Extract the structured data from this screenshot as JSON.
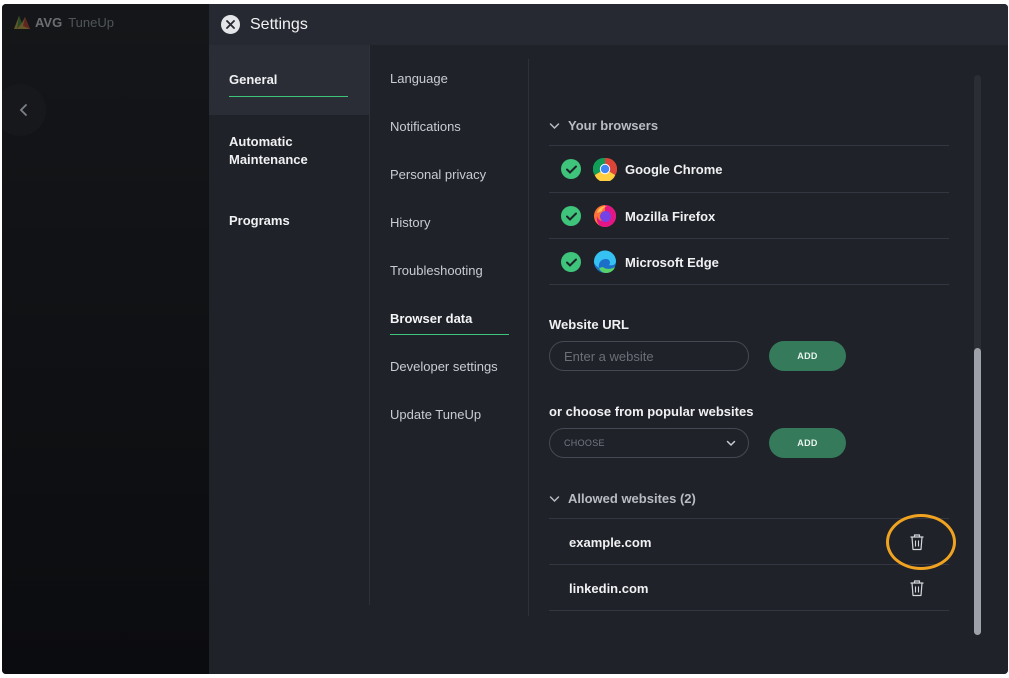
{
  "app": {
    "brand": "AVG",
    "product": "TuneUp"
  },
  "settings": {
    "title": "Settings"
  },
  "nav_primary": [
    {
      "label": "General",
      "active": true
    },
    {
      "label": "Automatic Maintenance",
      "active": false
    },
    {
      "label": "Programs",
      "active": false
    }
  ],
  "nav_secondary": [
    {
      "label": "Language",
      "active": false
    },
    {
      "label": "Notifications",
      "active": false
    },
    {
      "label": "Personal privacy",
      "active": false
    },
    {
      "label": "History",
      "active": false
    },
    {
      "label": "Troubleshooting",
      "active": false
    },
    {
      "label": "Browser data",
      "active": true
    },
    {
      "label": "Developer settings",
      "active": false
    },
    {
      "label": "Update TuneUp",
      "active": false
    }
  ],
  "browsers": {
    "heading": "Your browsers",
    "items": [
      {
        "name": "Google Chrome",
        "checked": true,
        "icon": "chrome-icon"
      },
      {
        "name": "Mozilla Firefox",
        "checked": true,
        "icon": "firefox-icon"
      },
      {
        "name": "Microsoft Edge",
        "checked": true,
        "icon": "edge-icon"
      }
    ]
  },
  "website_url": {
    "label": "Website URL",
    "placeholder": "Enter a website",
    "value": "",
    "add_label": "ADD"
  },
  "popular": {
    "label": "or choose from popular websites",
    "select_value": "CHOOSE",
    "add_label": "ADD"
  },
  "allowed": {
    "heading": "Allowed websites (2)",
    "items": [
      {
        "name": "example.com",
        "highlighted": true
      },
      {
        "name": "linkedin.com",
        "highlighted": false
      }
    ]
  },
  "colors": {
    "accent_green": "#3ec47b",
    "add_button": "#347a5b",
    "highlight_ring": "#f0a321",
    "panel_bg": "#1f2228"
  }
}
